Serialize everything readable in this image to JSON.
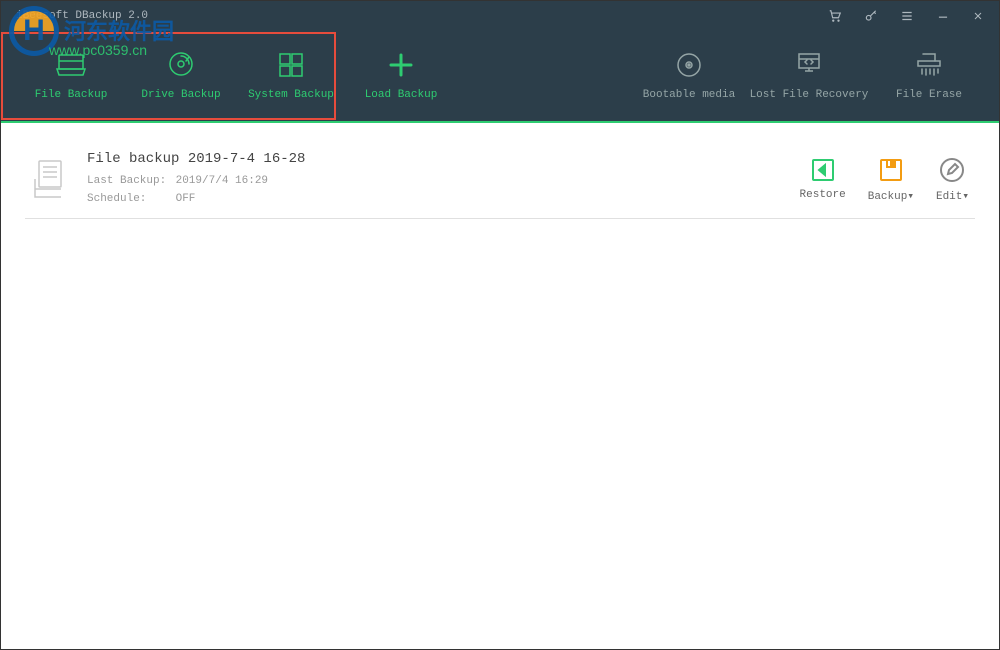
{
  "window": {
    "title": "iBeesoft DBackup 2.0"
  },
  "toolbar": {
    "file_backup": "File Backup",
    "drive_backup": "Drive Backup",
    "system_backup": "System Backup",
    "load_backup": "Load Backup",
    "bootable_media": "Bootable media",
    "lost_file_recovery": "Lost File Recovery",
    "file_erase": "File Erase"
  },
  "card": {
    "title": "File backup 2019-7-4 16-28",
    "last_backup_label": "Last Backup:",
    "last_backup_value": "2019/7/4 16:29",
    "schedule_label": "Schedule:",
    "schedule_value": "OFF",
    "restore": "Restore",
    "backup": "Backup▾",
    "edit": "Edit▾"
  },
  "watermark": {
    "site_name": "河东软件园",
    "url": "www.pc0359.cn"
  },
  "colors": {
    "accent": "#2ecc71",
    "header_bg": "#2c3e4a",
    "action_backup": "#f39c12",
    "muted": "#95a5a6"
  }
}
